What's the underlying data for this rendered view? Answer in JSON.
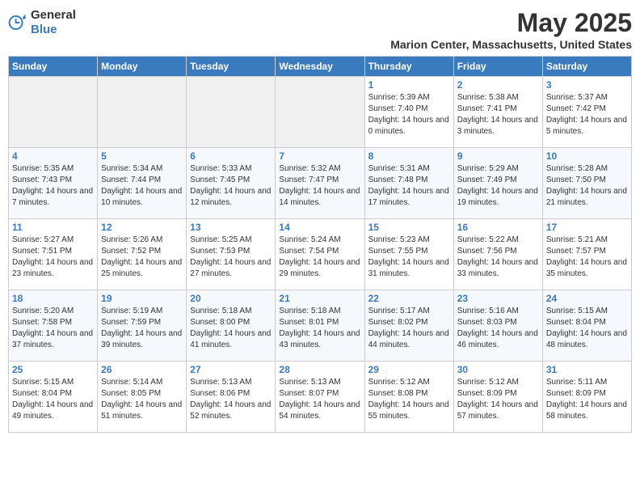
{
  "header": {
    "logo_general": "General",
    "logo_blue": "Blue",
    "month_title": "May 2025",
    "location": "Marion Center, Massachusetts, United States"
  },
  "weekdays": [
    "Sunday",
    "Monday",
    "Tuesday",
    "Wednesday",
    "Thursday",
    "Friday",
    "Saturday"
  ],
  "weeks": [
    [
      {
        "day": "",
        "text": ""
      },
      {
        "day": "",
        "text": ""
      },
      {
        "day": "",
        "text": ""
      },
      {
        "day": "",
        "text": ""
      },
      {
        "day": "1",
        "text": "Sunrise: 5:39 AM\nSunset: 7:40 PM\nDaylight: 14 hours and 0 minutes."
      },
      {
        "day": "2",
        "text": "Sunrise: 5:38 AM\nSunset: 7:41 PM\nDaylight: 14 hours and 3 minutes."
      },
      {
        "day": "3",
        "text": "Sunrise: 5:37 AM\nSunset: 7:42 PM\nDaylight: 14 hours and 5 minutes."
      }
    ],
    [
      {
        "day": "4",
        "text": "Sunrise: 5:35 AM\nSunset: 7:43 PM\nDaylight: 14 hours and 7 minutes."
      },
      {
        "day": "5",
        "text": "Sunrise: 5:34 AM\nSunset: 7:44 PM\nDaylight: 14 hours and 10 minutes."
      },
      {
        "day": "6",
        "text": "Sunrise: 5:33 AM\nSunset: 7:45 PM\nDaylight: 14 hours and 12 minutes."
      },
      {
        "day": "7",
        "text": "Sunrise: 5:32 AM\nSunset: 7:47 PM\nDaylight: 14 hours and 14 minutes."
      },
      {
        "day": "8",
        "text": "Sunrise: 5:31 AM\nSunset: 7:48 PM\nDaylight: 14 hours and 17 minutes."
      },
      {
        "day": "9",
        "text": "Sunrise: 5:29 AM\nSunset: 7:49 PM\nDaylight: 14 hours and 19 minutes."
      },
      {
        "day": "10",
        "text": "Sunrise: 5:28 AM\nSunset: 7:50 PM\nDaylight: 14 hours and 21 minutes."
      }
    ],
    [
      {
        "day": "11",
        "text": "Sunrise: 5:27 AM\nSunset: 7:51 PM\nDaylight: 14 hours and 23 minutes."
      },
      {
        "day": "12",
        "text": "Sunrise: 5:26 AM\nSunset: 7:52 PM\nDaylight: 14 hours and 25 minutes."
      },
      {
        "day": "13",
        "text": "Sunrise: 5:25 AM\nSunset: 7:53 PM\nDaylight: 14 hours and 27 minutes."
      },
      {
        "day": "14",
        "text": "Sunrise: 5:24 AM\nSunset: 7:54 PM\nDaylight: 14 hours and 29 minutes."
      },
      {
        "day": "15",
        "text": "Sunrise: 5:23 AM\nSunset: 7:55 PM\nDaylight: 14 hours and 31 minutes."
      },
      {
        "day": "16",
        "text": "Sunrise: 5:22 AM\nSunset: 7:56 PM\nDaylight: 14 hours and 33 minutes."
      },
      {
        "day": "17",
        "text": "Sunrise: 5:21 AM\nSunset: 7:57 PM\nDaylight: 14 hours and 35 minutes."
      }
    ],
    [
      {
        "day": "18",
        "text": "Sunrise: 5:20 AM\nSunset: 7:58 PM\nDaylight: 14 hours and 37 minutes."
      },
      {
        "day": "19",
        "text": "Sunrise: 5:19 AM\nSunset: 7:59 PM\nDaylight: 14 hours and 39 minutes."
      },
      {
        "day": "20",
        "text": "Sunrise: 5:18 AM\nSunset: 8:00 PM\nDaylight: 14 hours and 41 minutes."
      },
      {
        "day": "21",
        "text": "Sunrise: 5:18 AM\nSunset: 8:01 PM\nDaylight: 14 hours and 43 minutes."
      },
      {
        "day": "22",
        "text": "Sunrise: 5:17 AM\nSunset: 8:02 PM\nDaylight: 14 hours and 44 minutes."
      },
      {
        "day": "23",
        "text": "Sunrise: 5:16 AM\nSunset: 8:03 PM\nDaylight: 14 hours and 46 minutes."
      },
      {
        "day": "24",
        "text": "Sunrise: 5:15 AM\nSunset: 8:04 PM\nDaylight: 14 hours and 48 minutes."
      }
    ],
    [
      {
        "day": "25",
        "text": "Sunrise: 5:15 AM\nSunset: 8:04 PM\nDaylight: 14 hours and 49 minutes."
      },
      {
        "day": "26",
        "text": "Sunrise: 5:14 AM\nSunset: 8:05 PM\nDaylight: 14 hours and 51 minutes."
      },
      {
        "day": "27",
        "text": "Sunrise: 5:13 AM\nSunset: 8:06 PM\nDaylight: 14 hours and 52 minutes."
      },
      {
        "day": "28",
        "text": "Sunrise: 5:13 AM\nSunset: 8:07 PM\nDaylight: 14 hours and 54 minutes."
      },
      {
        "day": "29",
        "text": "Sunrise: 5:12 AM\nSunset: 8:08 PM\nDaylight: 14 hours and 55 minutes."
      },
      {
        "day": "30",
        "text": "Sunrise: 5:12 AM\nSunset: 8:09 PM\nDaylight: 14 hours and 57 minutes."
      },
      {
        "day": "31",
        "text": "Sunrise: 5:11 AM\nSunset: 8:09 PM\nDaylight: 14 hours and 58 minutes."
      }
    ]
  ]
}
